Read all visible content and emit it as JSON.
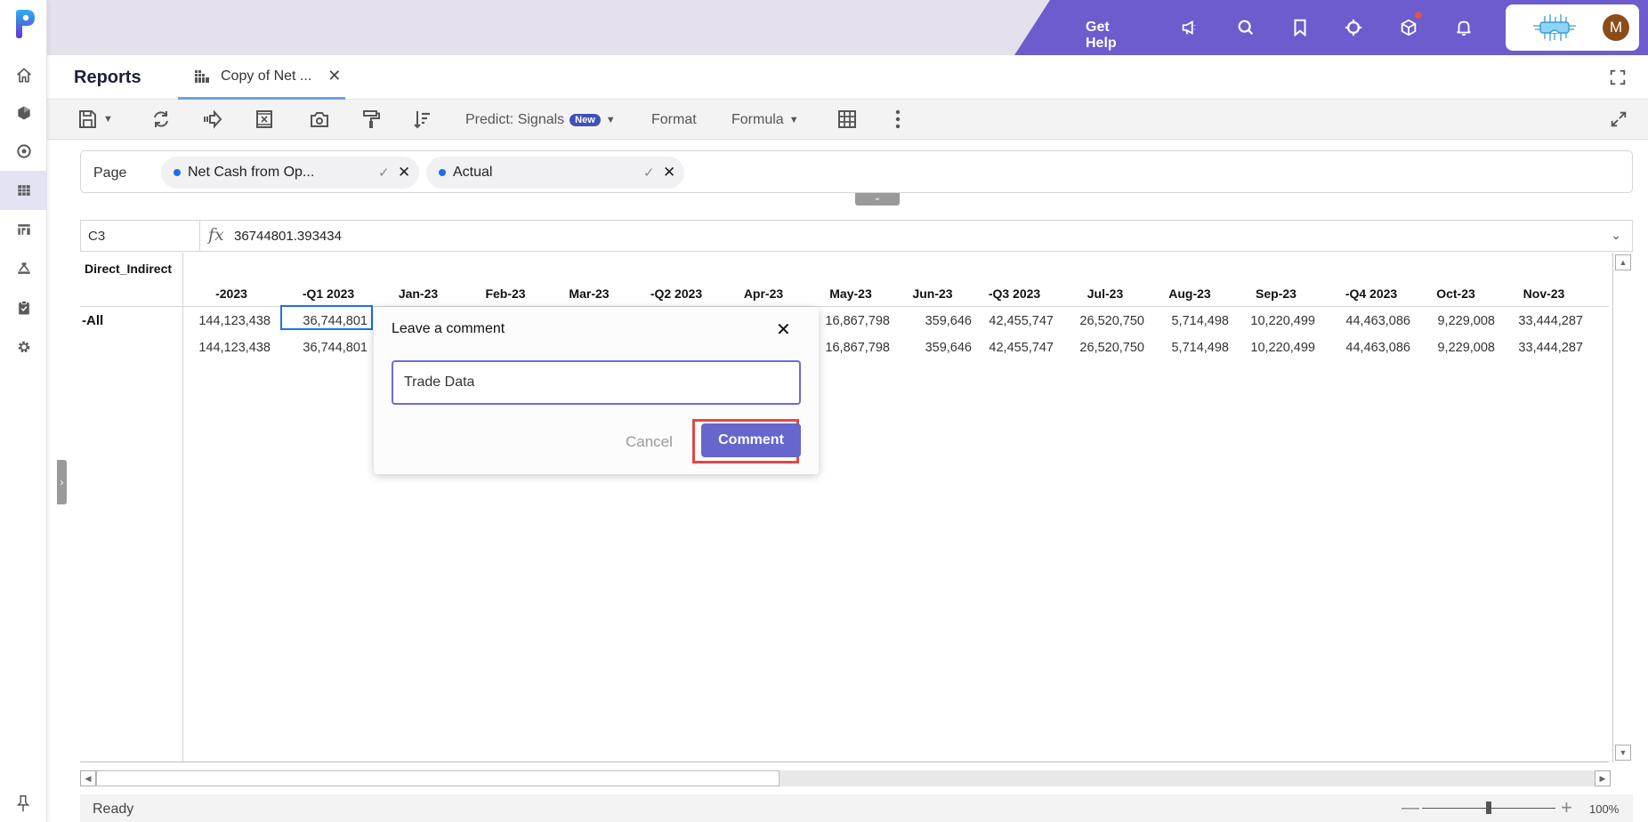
{
  "app": {
    "brand_letter": "P"
  },
  "leftnav": {
    "items": [
      {
        "icon": "home-icon",
        "active": false
      },
      {
        "icon": "cube-icon",
        "active": false
      },
      {
        "icon": "target-icon",
        "active": false
      },
      {
        "icon": "grid-icon",
        "active": true
      },
      {
        "icon": "dashboard-icon",
        "active": false
      },
      {
        "icon": "hierarchy-icon",
        "active": false
      },
      {
        "icon": "clipboard-check-icon",
        "active": false
      },
      {
        "icon": "gear-icon",
        "active": false
      }
    ],
    "pin_icon": "pin-icon"
  },
  "topbar": {
    "get_help": "Get Help",
    "icons": [
      "megaphone-icon",
      "search-icon",
      "bookmark-icon",
      "crosshair-icon",
      "box-icon",
      "bell-icon"
    ],
    "avatar_initial": "M",
    "notification_color": "#e05252",
    "accent": "#6c5ccd"
  },
  "tabs": {
    "section_title": "Reports",
    "active_tab": "Copy of Net ...",
    "close": "✕"
  },
  "toolbar": {
    "predict_label": "Predict: Signals",
    "new_badge": "New",
    "format_label": "Format",
    "formula_label": "Formula"
  },
  "page_filter": {
    "label": "Page",
    "chips": [
      {
        "label": "Net Cash from Op..."
      },
      {
        "label": "Actual"
      }
    ]
  },
  "formula_bar": {
    "cell_ref": "C3",
    "fx": "fx",
    "value": "36744801.393434"
  },
  "grid": {
    "dimension_label": "Direct_Indirect",
    "columns": [
      "-2023",
      "-Q1 2023",
      "Jan-23",
      "Feb-23",
      "Mar-23",
      "-Q2 2023",
      "Apr-23",
      "May-23",
      "Jun-23",
      "-Q3 2023",
      "Jul-23",
      "Aug-23",
      "Sep-23",
      "-Q4 2023",
      "Oct-23",
      "Nov-23"
    ],
    "rows": [
      {
        "label": "-All",
        "values": {
          "-2023": "144,123,438",
          "-Q1 2023": "36,744,801",
          "May-23": "16,867,798",
          "Jun-23": "359,646",
          "-Q3 2023": "42,455,747",
          "Jul-23": "26,520,750",
          "Aug-23": "5,714,498",
          "Sep-23": "10,220,499",
          "-Q4 2023": "44,463,086",
          "Oct-23": "9,229,008",
          "Nov-23": "33,444,287"
        }
      },
      {
        "label": "",
        "values": {
          "-2023": "144,123,438",
          "-Q1 2023": "36,744,801",
          "May-23": "16,867,798",
          "Jun-23": "359,646",
          "-Q3 2023": "42,455,747",
          "Jul-23": "26,520,750",
          "Aug-23": "5,714,498",
          "Sep-23": "10,220,499",
          "-Q4 2023": "44,463,086",
          "Oct-23": "9,229,008",
          "Nov-23": "33,444,287"
        }
      }
    ],
    "selected_cell": "C3"
  },
  "status": {
    "text": "Ready",
    "zoom": "100%",
    "zoom_fraction": 0.5
  },
  "dialog": {
    "title": "Leave a comment",
    "input_value": "Trade Data",
    "cancel_label": "Cancel",
    "submit_label": "Comment"
  }
}
